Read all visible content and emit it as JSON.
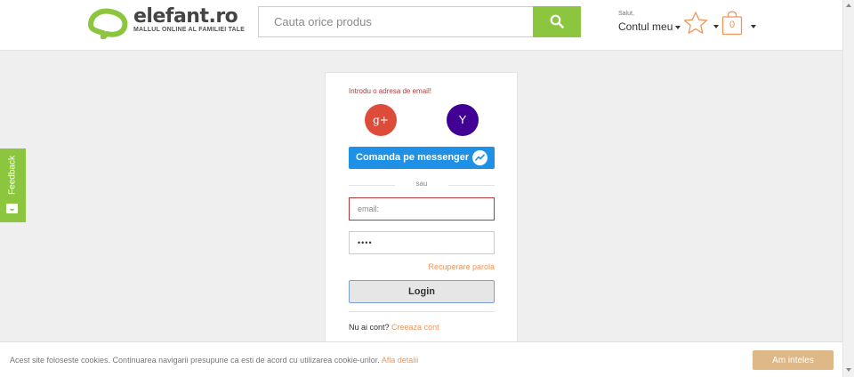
{
  "header": {
    "logo_text": "elefant.ro",
    "logo_tagline": "MALLUL ONLINE AL FAMILIEI TALE",
    "search_placeholder": "Cauta orice produs",
    "account_greeting": "Salut,",
    "account_link": "Contul meu",
    "cart_count": "0"
  },
  "feedback": {
    "label": "Feedback"
  },
  "login": {
    "email_error": "Introdu o adresa de email!",
    "google_label": "g+",
    "yahoo_label": "Y",
    "messenger_label": "Comanda pe messenger",
    "separator": "sau",
    "email_placeholder": "email:",
    "password_value": "••••",
    "recover_link": "Recuperare parola",
    "login_button": "Login",
    "no_account": "Nu ai cont?",
    "create_account": "Creeaza cont"
  },
  "cookie": {
    "text": "Acest site foloseste cookies. Continuarea navigarii presupune ca esti de acord cu utilizarea cookie-urilor.",
    "details_link": "Afla detalii",
    "accept_button": "Am inteles"
  },
  "colors": {
    "brand_green": "#8cc63f",
    "accent_orange": "#f0955a",
    "error_red": "#b03a3a",
    "google_red": "#dd4b39",
    "yahoo_purple": "#410093",
    "messenger_blue": "#1e90e6",
    "cookie_button": "#deb887"
  },
  "icons": {
    "logo": "elephant-logo-icon",
    "search": "search-icon",
    "wishlist": "star-icon",
    "cart": "shopping-bag-icon",
    "messenger": "messenger-icon",
    "feedback": "feedback-icon"
  }
}
